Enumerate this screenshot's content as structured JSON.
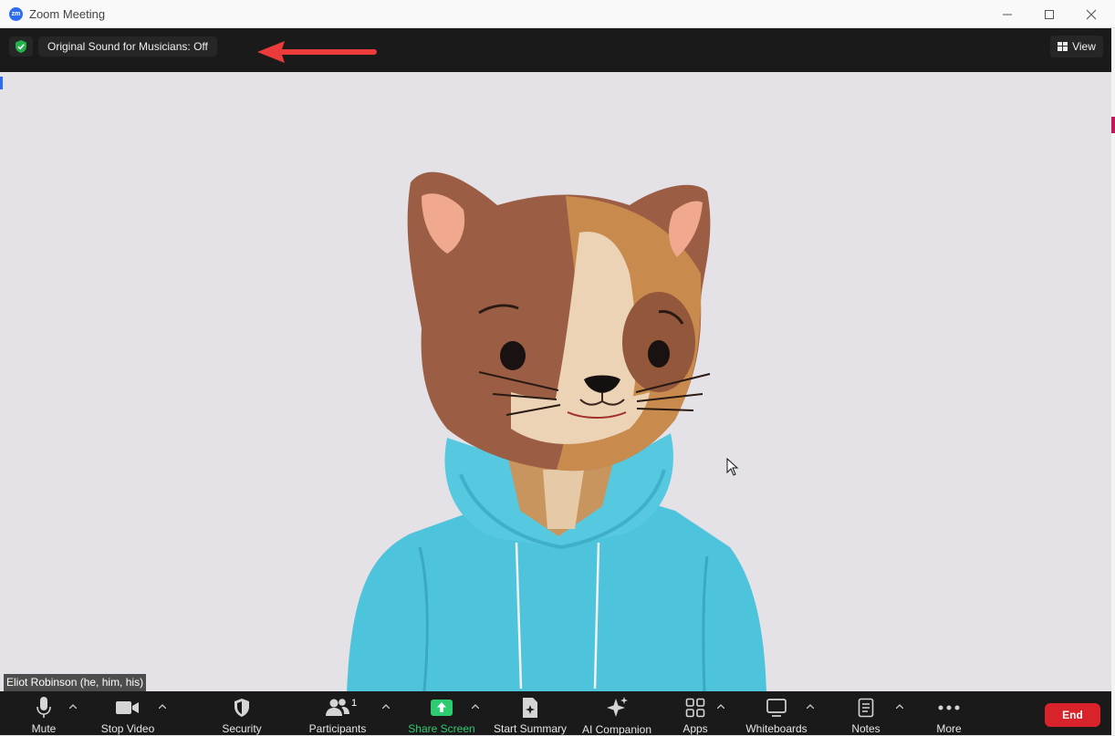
{
  "window": {
    "title": "Zoom Meeting",
    "logo_text": "zm"
  },
  "topbar": {
    "original_sound_label": "Original Sound for Musicians: Off",
    "view_label": "View"
  },
  "video": {
    "participant_name": "Eliot Robinson (he, him, his)"
  },
  "toolbar": {
    "mute_label": "Mute",
    "stop_video_label": "Stop Video",
    "security_label": "Security",
    "participants_label": "Participants",
    "participants_count": "1",
    "share_screen_label": "Share Screen",
    "start_summary_label": "Start Summary",
    "ai_companion_label": "AI Companion",
    "apps_label": "Apps",
    "whiteboards_label": "Whiteboards",
    "notes_label": "Notes",
    "more_label": "More",
    "end_label": "End"
  },
  "colors": {
    "toolbar_bg": "#1a1a1a",
    "share_green": "#2ecc71",
    "end_red": "#d9232a",
    "annotation_arrow": "#ec3b3b",
    "video_bg": "#e4e2e6"
  }
}
